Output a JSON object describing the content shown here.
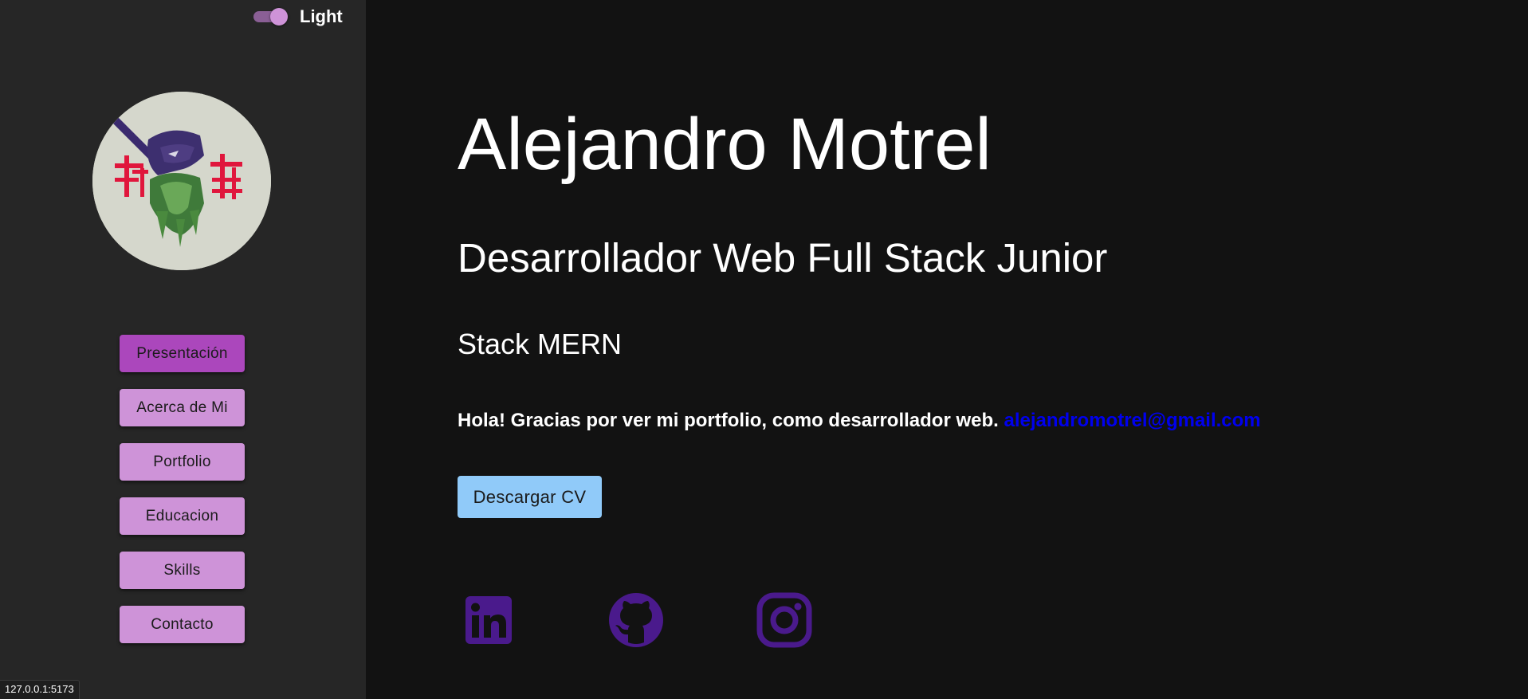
{
  "theme_toggle": {
    "label": "Light"
  },
  "nav": {
    "items": [
      {
        "label": "Presentación",
        "active": true
      },
      {
        "label": "Acerca de Mi"
      },
      {
        "label": "Portfolio"
      },
      {
        "label": "Educacion"
      },
      {
        "label": "Skills"
      },
      {
        "label": "Contacto"
      }
    ]
  },
  "hero": {
    "name": "Alejandro Motrel",
    "role": "Desarrollador Web Full Stack Junior",
    "stack": "Stack MERN",
    "intro": "Hola! Gracias por ver mi portfolio, como desarrollador web.",
    "email": "alejandromotrel@gmail.com",
    "cv_button": "Descargar CV"
  },
  "socials": [
    "linkedin-icon",
    "github-icon",
    "instagram-icon"
  ],
  "status_url": "127.0.0.1:5173",
  "colors": {
    "nav_button": "#ce93d8",
    "nav_button_active": "#ab47bc",
    "cv_button": "#90caf9",
    "social_icons": "#4a1a8c",
    "email_link": "#0000ee"
  }
}
